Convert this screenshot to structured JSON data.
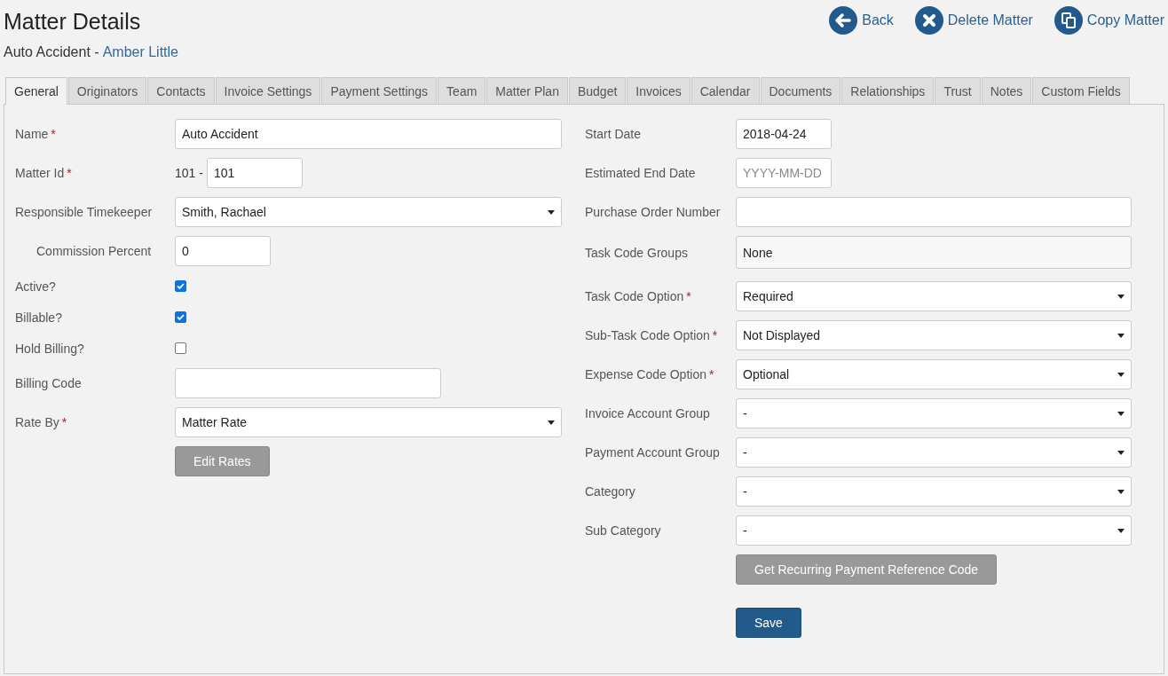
{
  "header": {
    "title": "Matter Details",
    "subtitle": "Auto Accident -",
    "client_link": "Amber Little"
  },
  "actions": [
    {
      "kind": "back",
      "label": "Back"
    },
    {
      "kind": "delete",
      "label": "Delete Matter"
    },
    {
      "kind": "copy",
      "label": "Copy Matter"
    }
  ],
  "tabs": [
    {
      "label": "General",
      "selected": true
    },
    {
      "label": "Originators",
      "selected": false
    },
    {
      "label": "Contacts",
      "selected": false
    },
    {
      "label": "Invoice Settings",
      "selected": false
    },
    {
      "label": "Payment Settings",
      "selected": false
    },
    {
      "label": "Team",
      "selected": false
    },
    {
      "label": "Matter Plan",
      "selected": false
    },
    {
      "label": "Budget",
      "selected": false
    },
    {
      "label": "Invoices",
      "selected": false
    },
    {
      "label": "Calendar",
      "selected": false
    },
    {
      "label": "Documents",
      "selected": false
    },
    {
      "label": "Relationships",
      "selected": false
    },
    {
      "label": "Trust",
      "selected": false
    },
    {
      "label": "Notes",
      "selected": false
    },
    {
      "label": "Custom Fields",
      "selected": false
    }
  ],
  "left_fields": [
    {
      "kind": "text",
      "label": "Name",
      "required_mark": "*",
      "value": "Auto Accident"
    },
    {
      "kind": "id",
      "label": "Matter Id",
      "required_mark": "*",
      "prefix": "101 -",
      "value": "101"
    },
    {
      "kind": "select",
      "label": "Responsible Timekeeper",
      "value": "Smith, Rachael"
    },
    {
      "kind": "subfield",
      "label": "Commission Percent",
      "value": "0"
    },
    {
      "kind": "checkbox",
      "label": "Active?",
      "checked": true
    },
    {
      "kind": "checkbox",
      "label": "Billable?",
      "checked": true
    },
    {
      "kind": "checkbox",
      "label": "Hold Billing?",
      "checked": false
    },
    {
      "kind": "code",
      "label": "Billing Code"
    },
    {
      "kind": "select",
      "label": "Rate By",
      "required_mark": "*",
      "value": "Matter Rate"
    },
    {
      "kind": "button",
      "label": "Edit Rates"
    }
  ],
  "right_fields": [
    {
      "kind": "date",
      "label": "Start Date",
      "value": "2018-04-24"
    },
    {
      "kind": "date",
      "label": "Estimated End Date",
      "placeholder": "YYYY-MM-DD"
    },
    {
      "kind": "text",
      "label": "Purchase Order Number"
    },
    {
      "kind": "readonly",
      "label": "Task Code Groups",
      "value": "None"
    },
    {
      "kind": "select",
      "label": "Task Code Option",
      "required_mark": "*",
      "value": "Required"
    },
    {
      "kind": "select",
      "label": "Sub-Task Code Option",
      "required_mark": "*",
      "value": "Not Displayed"
    },
    {
      "kind": "select",
      "label": "Expense Code Option",
      "required_mark": "*",
      "value": "Optional"
    },
    {
      "kind": "select",
      "label": "Invoice Account Group",
      "value": "-"
    },
    {
      "kind": "select",
      "label": "Payment Account Group",
      "value": "-"
    },
    {
      "kind": "select",
      "label": "Category",
      "value": "-"
    },
    {
      "kind": "select",
      "label": "Sub Category",
      "value": "-"
    },
    {
      "kind": "button",
      "label": "Get Recurring Payment Reference Code"
    },
    {
      "kind": "primary",
      "label": "Save"
    }
  ]
}
